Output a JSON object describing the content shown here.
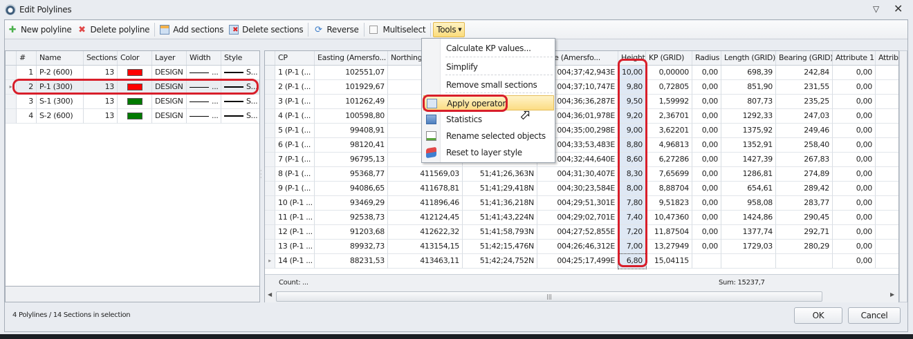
{
  "window": {
    "title": "Edit Polylines"
  },
  "toolbar": {
    "new_polyline": "New polyline",
    "delete_polyline": "Delete polyline",
    "add_sections": "Add sections",
    "delete_sections": "Delete sections",
    "reverse": "Reverse",
    "multiselect": "Multiselect",
    "tools": "Tools"
  },
  "polylines": {
    "columns": [
      "#",
      "Name",
      "Sections",
      "Color",
      "Layer",
      "Width",
      "Style"
    ],
    "rows": [
      {
        "num": "1",
        "name": "P-2 (600)",
        "sections": "13",
        "color": "#ff0000",
        "layer": "DESIGN",
        "width": "...",
        "style": "S..."
      },
      {
        "num": "2",
        "name": "P-1 (300)",
        "sections": "13",
        "color": "#ff0000",
        "layer": "DESIGN",
        "width": "...",
        "style": "S...",
        "selected": true
      },
      {
        "num": "3",
        "name": "S-1 (300)",
        "sections": "13",
        "color": "#007a00",
        "layer": "DESIGN",
        "width": "...",
        "style": "S..."
      },
      {
        "num": "4",
        "name": "S-2 (600)",
        "sections": "13",
        "color": "#007a00",
        "layer": "DESIGN",
        "width": "...",
        "style": "S..."
      }
    ]
  },
  "sections": {
    "columns": [
      "CP",
      "Easting (Amersfo...",
      "Northing (",
      "",
      "itude (Amersfo...",
      "Height",
      "KP (GRID)",
      "Radius",
      "Length (GRID)",
      "Bearing (GRID)",
      "Attribute 1",
      "Attribu"
    ],
    "rows": [
      [
        "1 (P-1 (...",
        "102551,07",
        "",
        "",
        "004;37;42,943E",
        "10,00",
        "0,00000",
        "0,00",
        "698,39",
        "242,84",
        "0,00",
        ""
      ],
      [
        "2 (P-1 (...",
        "101929,67",
        "",
        "",
        "004;37;10,747E",
        "9,80",
        "0,72805",
        "0,00",
        "851,90",
        "231,55",
        "0,00",
        ""
      ],
      [
        "3 (P-1 (...",
        "101262,49",
        "",
        "",
        "004;36;36,287E",
        "9,50",
        "1,59992",
        "0,00",
        "807,73",
        "235,25",
        "0,00",
        ""
      ],
      [
        "4 (P-1 (...",
        "100598,80",
        "",
        "",
        "004;36;01,978E",
        "9,20",
        "2,36701",
        "0,00",
        "1292,33",
        "247,03",
        "0,00",
        ""
      ],
      [
        "5 (P-1 (...",
        "99408,91",
        "",
        "",
        "004;35;00,298E",
        "9,00",
        "3,62201",
        "0,00",
        "1375,92",
        "249,46",
        "0,00",
        ""
      ],
      [
        "6 (P-1 (...",
        "98120,41",
        "",
        "",
        "004;33;53,483E",
        "8,80",
        "4,96813",
        "0,00",
        "1352,91",
        "258,40",
        "0,00",
        ""
      ],
      [
        "7 (P-1 (...",
        "96795,13",
        "",
        "",
        "004;32;44,640E",
        "8,60",
        "6,27286",
        "0,00",
        "1427,39",
        "267,83",
        "0,00",
        ""
      ],
      [
        "8 (P-1 (...",
        "95368,77",
        "411569,03",
        "51;41;26,363N",
        "004;31;30,407E",
        "8,30",
        "7,65699",
        "0,00",
        "1286,81",
        "274,89",
        "0,00",
        ""
      ],
      [
        "9 (P-1 (...",
        "94086,65",
        "411678,81",
        "51;41;29,418N",
        "004;30;23,584E",
        "8,00",
        "8,88704",
        "0,00",
        "654,61",
        "289,42",
        "0,00",
        ""
      ],
      [
        "10 (P-1 ...",
        "93469,29",
        "411896,46",
        "51;41;36,218N",
        "004;29;51,301E",
        "7,80",
        "9,51823",
        "0,00",
        "958,08",
        "283,77",
        "0,00",
        ""
      ],
      [
        "11 (P-1 ...",
        "92538,73",
        "412124,45",
        "51;41;43,224N",
        "004;29;02,701E",
        "7,40",
        "10,47360",
        "0,00",
        "1424,86",
        "290,45",
        "0,00",
        ""
      ],
      [
        "12 (P-1 ...",
        "91203,68",
        "412622,32",
        "51;41;58,793N",
        "004;27;52,855E",
        "7,20",
        "11,87504",
        "0,00",
        "1377,74",
        "292,71",
        "0,00",
        ""
      ],
      [
        "13 (P-1 ...",
        "89932,73",
        "413154,15",
        "51;42;15,476N",
        "004;26;46,312E",
        "7,00",
        "13,27949",
        "0,00",
        "1729,03",
        "280,29",
        "0,00",
        ""
      ],
      [
        "14 (P-1 ...",
        "88231,53",
        "413463,11",
        "51;42;24,752N",
        "004;25;17,499E",
        "6,80",
        "15,04115",
        "",
        "",
        "",
        "0,00",
        ""
      ]
    ],
    "footer_count": "Count: ...",
    "footer_sum": "Sum: 15237,7"
  },
  "menu": {
    "items": [
      "Calculate KP values...",
      "Simplify",
      "Remove small sections",
      "Apply operator",
      "Statistics",
      "Rename selected objects",
      "Reset to layer style"
    ]
  },
  "status": "4 Polylines / 14 Sections in selection",
  "buttons": {
    "ok": "OK",
    "cancel": "Cancel"
  }
}
